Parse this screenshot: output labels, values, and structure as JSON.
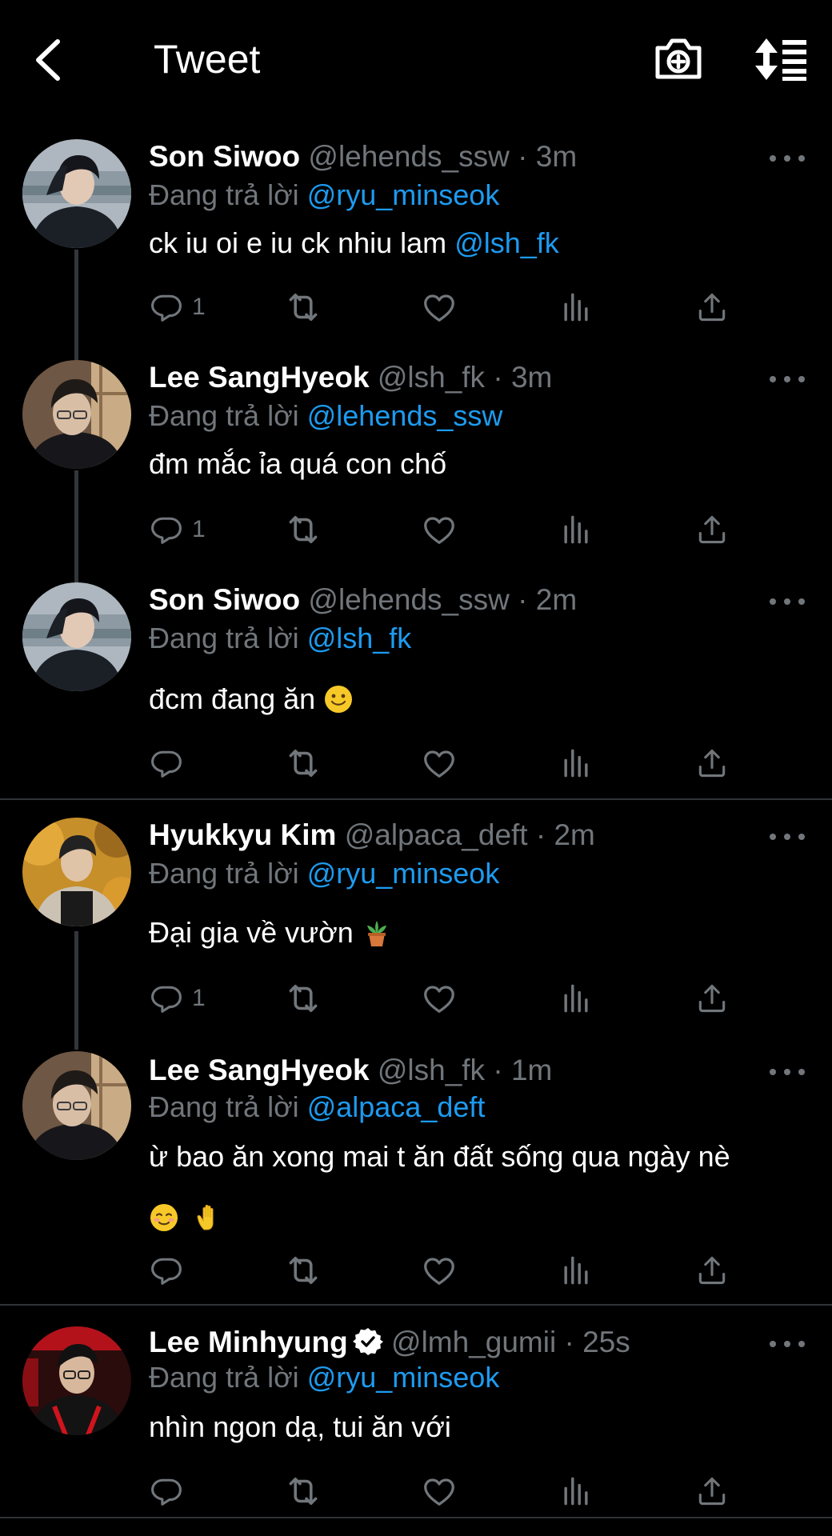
{
  "header": {
    "title": "Tweet",
    "back_icon": "chevron-left-icon",
    "camera_icon": "camera-plus-icon",
    "sort_icon": "sort-list-icon"
  },
  "colors": {
    "background": "#000000",
    "text_primary": "#ffffff",
    "text_secondary": "#71767b",
    "link": "#1d9bf0",
    "verified": "#ffffff"
  },
  "tweets": [
    {
      "name": "Son Siwoo",
      "handle": "@lehends_ssw",
      "sep": "·",
      "time": "3m",
      "reply_prefix": "Đang trả lời",
      "reply_to": "@ryu_minseok",
      "text": "ck iu oi e iu ck nhiu lam",
      "text_mention": "@lsh_fk",
      "reply_count": "1"
    },
    {
      "name": "Lee SangHyeok",
      "handle": "@lsh_fk",
      "sep": "·",
      "time": "3m",
      "reply_prefix": "Đang trả lời",
      "reply_to": "@lehends_ssw",
      "text": "đm mắc ỉa quá con chố",
      "reply_count": "1"
    },
    {
      "name": "Son Siwoo",
      "handle": "@lehends_ssw",
      "sep": "·",
      "time": "2m",
      "reply_prefix": "Đang trả lời",
      "reply_to": "@lsh_fk",
      "text": "đcm đang ăn",
      "emoji": "slightly-smiling-face",
      "reply_count": ""
    },
    {
      "name": "Hyukkyu Kim",
      "handle": "@alpaca_deft",
      "sep": "·",
      "time": "2m",
      "reply_prefix": "Đang trả lời",
      "reply_to": "@ryu_minseok",
      "text": "Đại gia về vườn",
      "emoji": "potted-plant",
      "reply_count": "1"
    },
    {
      "name": "Lee SangHyeok",
      "handle": "@lsh_fk",
      "sep": "·",
      "time": "1m",
      "reply_prefix": "Đang trả lời",
      "reply_to": "@alpaca_deft",
      "text": "ừ bao ăn xong mai t ăn đất sống qua ngày nè",
      "emoji": [
        "smiling-face",
        "raised-hand"
      ],
      "reply_count": ""
    },
    {
      "name": "Lee Minhyung",
      "verified": true,
      "handle": "@lmh_gumii",
      "sep": "·",
      "time": "25s",
      "reply_prefix": "Đang trả lời",
      "reply_to": "@ryu_minseok",
      "text": "nhìn ngon dạ, tui ăn với",
      "reply_count": ""
    }
  ],
  "action_icons": [
    "reply-icon",
    "retweet-icon",
    "like-icon",
    "views-icon",
    "share-icon"
  ]
}
